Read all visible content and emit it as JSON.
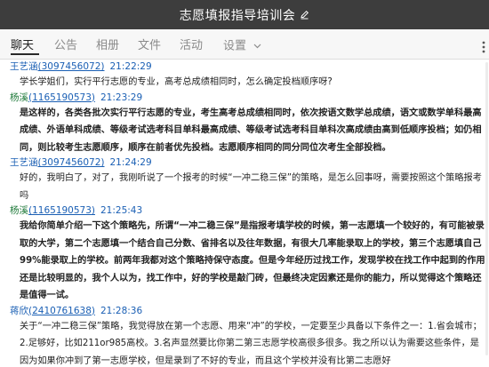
{
  "window": {
    "title": "志愿填报指导培训会"
  },
  "tabs": [
    {
      "label": "聊天"
    },
    {
      "label": "公告"
    },
    {
      "label": "相册"
    },
    {
      "label": "文件"
    },
    {
      "label": "活动"
    },
    {
      "label": "设置"
    }
  ],
  "colors": {
    "titlebar": "#3d3d3d",
    "link_blue": "#1a5fb4",
    "sender_green": "#1f7a3a"
  },
  "messages": [
    {
      "name": "王艺涵",
      "qq": "(3097456072)",
      "time": "21:22:29",
      "text": "学长学姐们，实行平行志愿的专业，高考总成绩相同时，怎么确定投档顺序呀?"
    },
    {
      "name": "杨溪",
      "qq": "(1165190573)",
      "time": "21:23:29",
      "text": "是这样的，各类各批次实行平行志愿的专业，考生高考总成绩相同时，依次按语文数学总成绩，语文或数学单科最高成绩、外语单科成绩、等级考试选考科目单科最高成绩、等级考试选考科目单科次高成绩由高到低顺序投档；如仍相同，则比较考生志愿顺序，顺序在前者优先投档。志愿顺序相同的同分同位次考生全部投档。"
    },
    {
      "name": "王艺涵",
      "qq": "(3097456072)",
      "time": "21:24:29",
      "text": "好的，我明白了，对了，我刚听说了一个报考的时候“一冲二稳三保”的策略，是怎么回事呀，需要按照这个策略报考吗"
    },
    {
      "name": "杨溪",
      "qq": "(1165190573)",
      "time": "21:25:43",
      "text": "我给你简单介绍一下这个策略先，所谓“一冲二稳三保”是指报考填学校的时候，第一志愿填一个较好的，有可能被录取的大学，第二个志愿填一个结合自己分数、省排名以及往年数据，有很大几率能录取上的学校，第三个志愿填自己99%能录取上的学校。前两年我都对这个策略持保守态度。但是今年经历过找工作，发现学校在找工作中起到的作用还是比较明显的，我个人以为，找工作中，好的学校是敲门砖，但最终决定因素还是你的能力，所以觉得这个策略还是值得一试。"
    },
    {
      "name": "蒋欣",
      "qq": "(2410761638)",
      "time": "21:28:36",
      "text": "关于“一冲二稳三保”策略，我觉得放在第一个志愿、用来“冲”的学校，一定要至少具备以下条件之一：1.省会城市；2.足够好，比如211or985高校。3.名声显然要比你第二第三志愿学校高很多很多。我之所以认为需要这些条件，是因为如果你冲到了第一志愿学校，但是录到了不好的专业，而且这个学校并没有比第二志愿好"
    }
  ]
}
